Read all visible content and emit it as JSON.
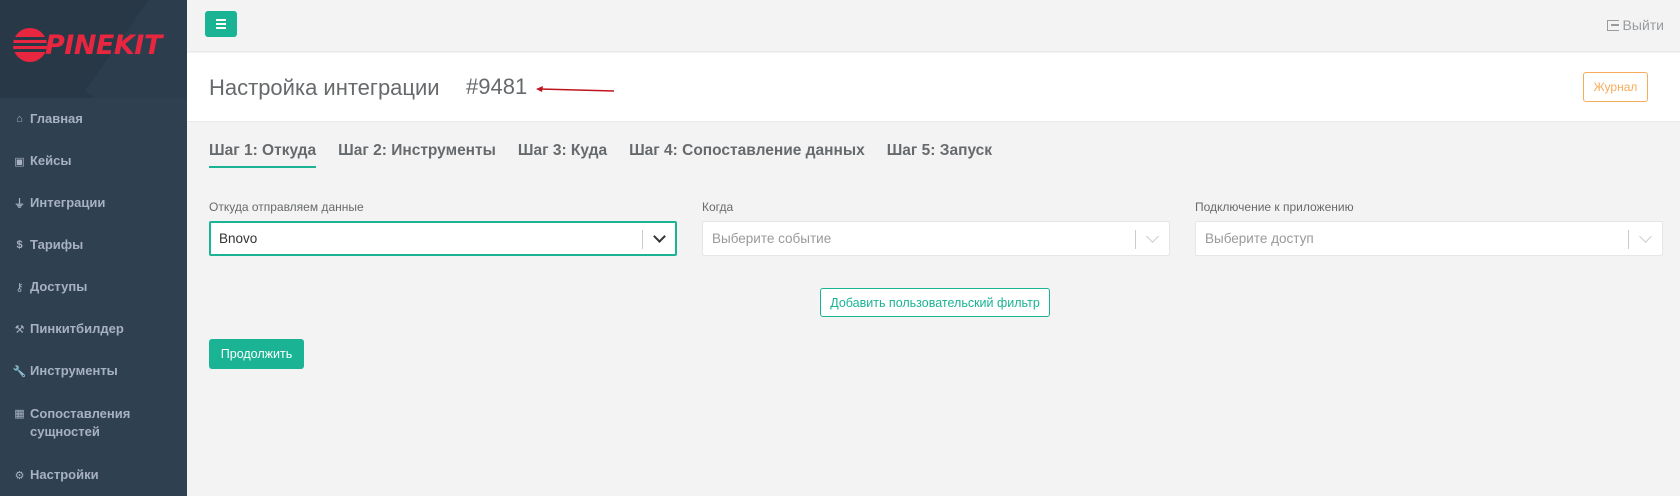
{
  "brand": {
    "logo_text": "PINEKIT"
  },
  "sidebar": {
    "items": [
      {
        "icon": "home-icon",
        "glyph": "⌂",
        "label": "Главная"
      },
      {
        "icon": "briefcase-icon",
        "glyph": "▣",
        "label": "Кейсы"
      },
      {
        "icon": "plug-icon",
        "glyph": "⏚",
        "label": "Интеграции"
      },
      {
        "icon": "dollar-icon",
        "glyph": "$",
        "label": "Тарифы"
      },
      {
        "icon": "key-icon",
        "glyph": "⚷",
        "label": "Доступы"
      },
      {
        "icon": "hammer-icon",
        "glyph": "⚒",
        "label": "Пинкитбилдер"
      },
      {
        "icon": "wrench-icon",
        "glyph": "🔧",
        "label": "Инструменты"
      },
      {
        "icon": "table-icon",
        "glyph": "▦",
        "label": "Сопоставления сущностей"
      },
      {
        "icon": "cogs-icon",
        "glyph": "⚙",
        "label": "Настройки"
      }
    ]
  },
  "topbar": {
    "logout_label": "Выйти"
  },
  "heading": {
    "title": "Настройка интеграции",
    "number": "#9481",
    "journal_label": "Журнал"
  },
  "tabs": [
    {
      "label": "Шаг 1: Откуда",
      "active": true
    },
    {
      "label": "Шаг 2: Инструменты",
      "active": false
    },
    {
      "label": "Шаг 3: Куда",
      "active": false
    },
    {
      "label": "Шаг 4: Сопоставление данных",
      "active": false
    },
    {
      "label": "Шаг 5: Запуск",
      "active": false
    }
  ],
  "form": {
    "source": {
      "label": "Откуда отправляем данные",
      "value": "Bnovo"
    },
    "event": {
      "label": "Когда",
      "placeholder": "Выберите событие"
    },
    "connection": {
      "label": "Подключение к приложению",
      "placeholder": "Выберите доступ"
    }
  },
  "buttons": {
    "add_filter": "Добавить пользовательский фильтр",
    "continue": "Продолжить"
  },
  "colors": {
    "accent": "#1ab394",
    "warning": "#f8ac59",
    "sidebar": "#2f4050",
    "brand": "#e8263f"
  }
}
